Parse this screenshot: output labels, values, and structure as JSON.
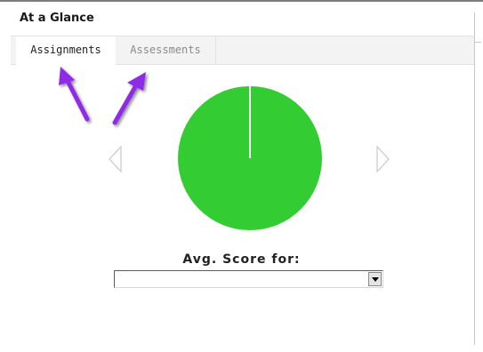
{
  "panel": {
    "title": "At a Glance"
  },
  "tabs": [
    {
      "label": "Assignments",
      "active": true
    },
    {
      "label": "Assessments",
      "active": false
    }
  ],
  "chart_data": {
    "type": "pie",
    "values": [
      100
    ],
    "colors": [
      "#33cc33"
    ]
  },
  "score": {
    "label": "Avg. Score for:",
    "selected": ""
  },
  "colors": {
    "pie_fill": "#33cc33",
    "annotation_arrow": "#8f2ce8",
    "nav_arrow": "#c8c8c8"
  },
  "icons": {
    "prev": "triangle-left-icon",
    "next": "triangle-right-icon",
    "dropdown": "chevron-down-icon"
  }
}
